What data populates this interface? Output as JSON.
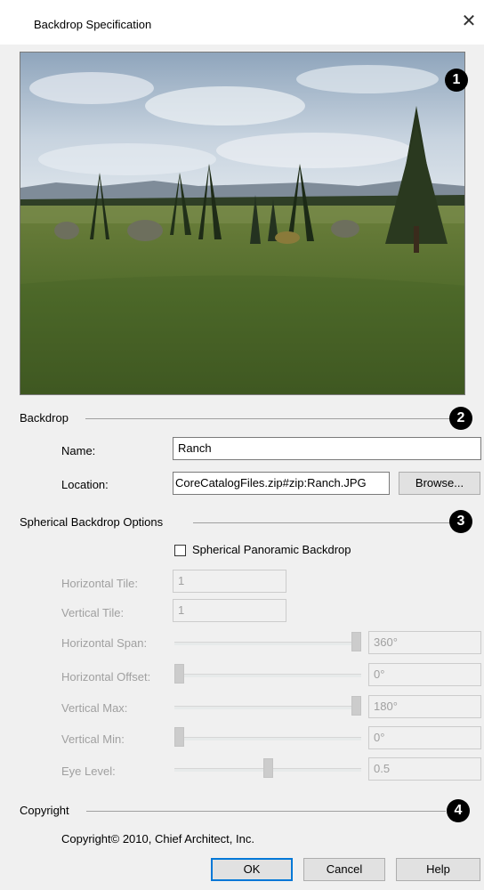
{
  "window": {
    "title": "Backdrop Specification",
    "close_icon": "close-icon"
  },
  "callouts": [
    "1",
    "2",
    "3",
    "4"
  ],
  "backdrop": {
    "group_label": "Backdrop",
    "name_label": "Name:",
    "name_value": "Ranch",
    "location_label": "Location:",
    "location_value": "CoreCatalogFiles.zip#zip:Ranch.JPG",
    "browse_label": "Browse..."
  },
  "spherical": {
    "group_label": "Spherical Backdrop Options",
    "checkbox_label": "Spherical Panoramic Backdrop",
    "checkbox_checked": false,
    "horizontal_tile_label": "Horizontal Tile:",
    "horizontal_tile_value": "1",
    "vertical_tile_label": "Vertical Tile:",
    "vertical_tile_value": "1",
    "sliders": [
      {
        "label": "Horizontal Span:",
        "value": "360°",
        "fraction": 1.0
      },
      {
        "label": "Horizontal Offset:",
        "value": "0°",
        "fraction": 0.0
      },
      {
        "label": "Vertical Max:",
        "value": "180°",
        "fraction": 1.0
      },
      {
        "label": "Vertical Min:",
        "value": "0°",
        "fraction": 0.0
      },
      {
        "label": "Eye Level:",
        "value": "0.5",
        "fraction": 0.5
      }
    ]
  },
  "copyright": {
    "group_label": "Copyright",
    "text": "Copyright© 2010, Chief Architect, Inc."
  },
  "buttons": {
    "ok": "OK",
    "cancel": "Cancel",
    "help": "Help"
  }
}
